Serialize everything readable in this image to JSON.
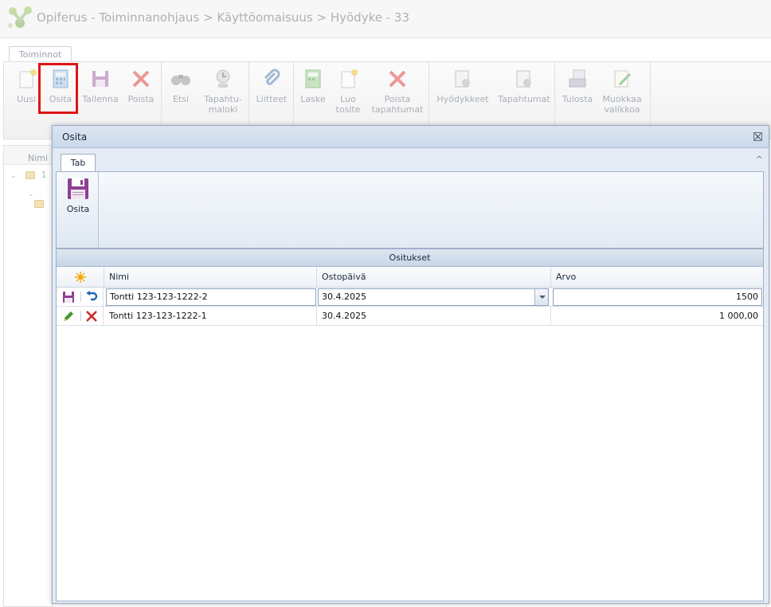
{
  "header": {
    "breadcrumb": "Opiferus - Toiminnanohjaus > Käyttöomaisuus > Hyödyke - 33"
  },
  "ribbon": {
    "tab_label": "Toiminnot",
    "buttons": {
      "uusi": "Uusi",
      "osita": "Osita",
      "tallenna": "Tallenna",
      "poista": "Poista",
      "etsi": "Etsi",
      "tapahtumaloki_1": "Tapahtu-",
      "tapahtumaloki_2": "maloki",
      "liitteet": "Liitteet",
      "laske": "Laske",
      "luo_tosite_1": "Luo",
      "luo_tosite_2": "tosite",
      "poista_tapahtumat_1": "Poista",
      "poista_tapahtumat_2": "tapahtumat",
      "hyodykkeet": "Hyödykkeet",
      "tapahtumat": "Tapahtumat",
      "tulosta": "Tulosta",
      "muokkaa_valikkoa_1": "Muokkaa",
      "muokkaa_valikkoa_2": "valikkoa"
    }
  },
  "background": {
    "column_header": "Nimi",
    "tree_row_1": "1"
  },
  "dialog": {
    "title": "Osita",
    "tab_label": "Tab",
    "save_button_label": "Osita",
    "grid": {
      "caption": "Ositukset",
      "columns": {
        "nimi": "Nimi",
        "ostopaiva": "Ostopäivä",
        "arvo": "Arvo"
      },
      "edit_row": {
        "nimi": "Tontti 123-123-1222-2",
        "ostopaiva": "30.4.2025",
        "arvo": "1500"
      },
      "rows": [
        {
          "nimi": "Tontti 123-123-1222-1",
          "ostopaiva": "30.4.2025",
          "arvo": "1 000,00"
        }
      ]
    }
  },
  "colors": {
    "highlight": "#e01414",
    "dialog_bg": "#e4ebf4",
    "dialog_border": "#97abc6"
  }
}
